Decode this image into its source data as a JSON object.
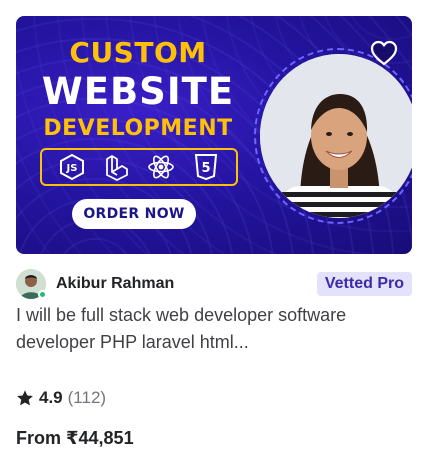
{
  "thumbnail": {
    "headline_line1": "CUSTOM",
    "headline_line2": "WEBSITE",
    "headline_line3": "DEVELOPMENT",
    "tech_icons": [
      "js-icon",
      "laravel-icon",
      "react-icon",
      "html5-icon"
    ],
    "tech_labels": [
      "JS",
      "",
      "",
      "5"
    ],
    "cta_label": "ORDER NOW",
    "colors": {
      "background": "#2414a0",
      "accent": "#ffc107",
      "text": "#ffffff"
    }
  },
  "favorite": {
    "icon": "heart-icon"
  },
  "seller": {
    "name": "Akibur Rahman",
    "badge": "Vetted Pro",
    "online": true
  },
  "gig": {
    "title": "I will be full stack web developer software developer PHP laravel html..."
  },
  "rating": {
    "icon": "star-icon",
    "value": "4.9",
    "count": "(112)"
  },
  "price": {
    "label": "From ₹44,851"
  }
}
